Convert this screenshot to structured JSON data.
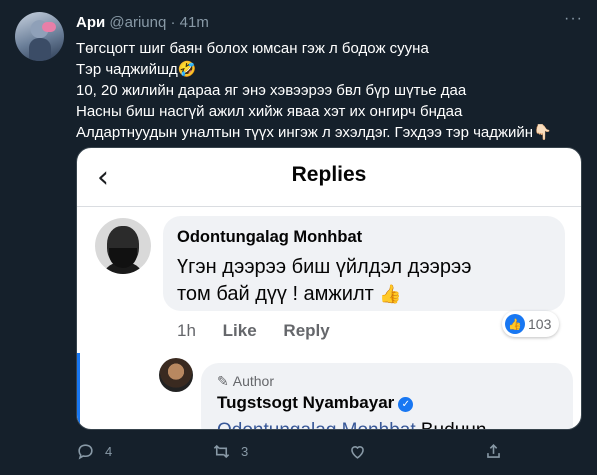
{
  "tweet": {
    "name": "Ари",
    "handle": "@ariunq",
    "separator": "·",
    "time": "41m",
    "more": "···",
    "lines": [
      "Төгсцогт шиг баян болох юмсан гэж л бодож сууна",
      "Тэр чаджийшд🤣",
      "10, 20 жилийн дараа яг энэ хэвээрээ бвл бүр шүтье даа",
      "Насны биш насгүй ажил хийж яваа хэт их онгирч бндаа",
      "Алдартнуудын уналтын түүх ингэж л эхэлдэг. Гэхдээ тэр чаджийн👇🏻"
    ]
  },
  "media": {
    "back_icon": "chevron-left-icon",
    "title": "Replies",
    "comment1": {
      "name": "Odontungalag Monhbat",
      "line1": "Үгэн дээрээ биш үйлдэл дээрээ",
      "line2": "том бай дүү ! амжилт",
      "emoji": "👍",
      "time": "1h",
      "like": "Like",
      "reply": "Reply",
      "reaction_count": "103"
    },
    "comment2": {
      "author_badge": "Author",
      "name": "Tugstsogt Nyambayar",
      "mention": "Odontungalag Monhbat",
      "text": " Buduun"
    }
  },
  "actions": {
    "reply_count": "4",
    "retweet_count": "3",
    "like_count": "",
    "share_count": ""
  },
  "colors": {
    "background": "#15202b",
    "secondary_text": "#8899a6",
    "facebook_blue": "#1877f2"
  }
}
